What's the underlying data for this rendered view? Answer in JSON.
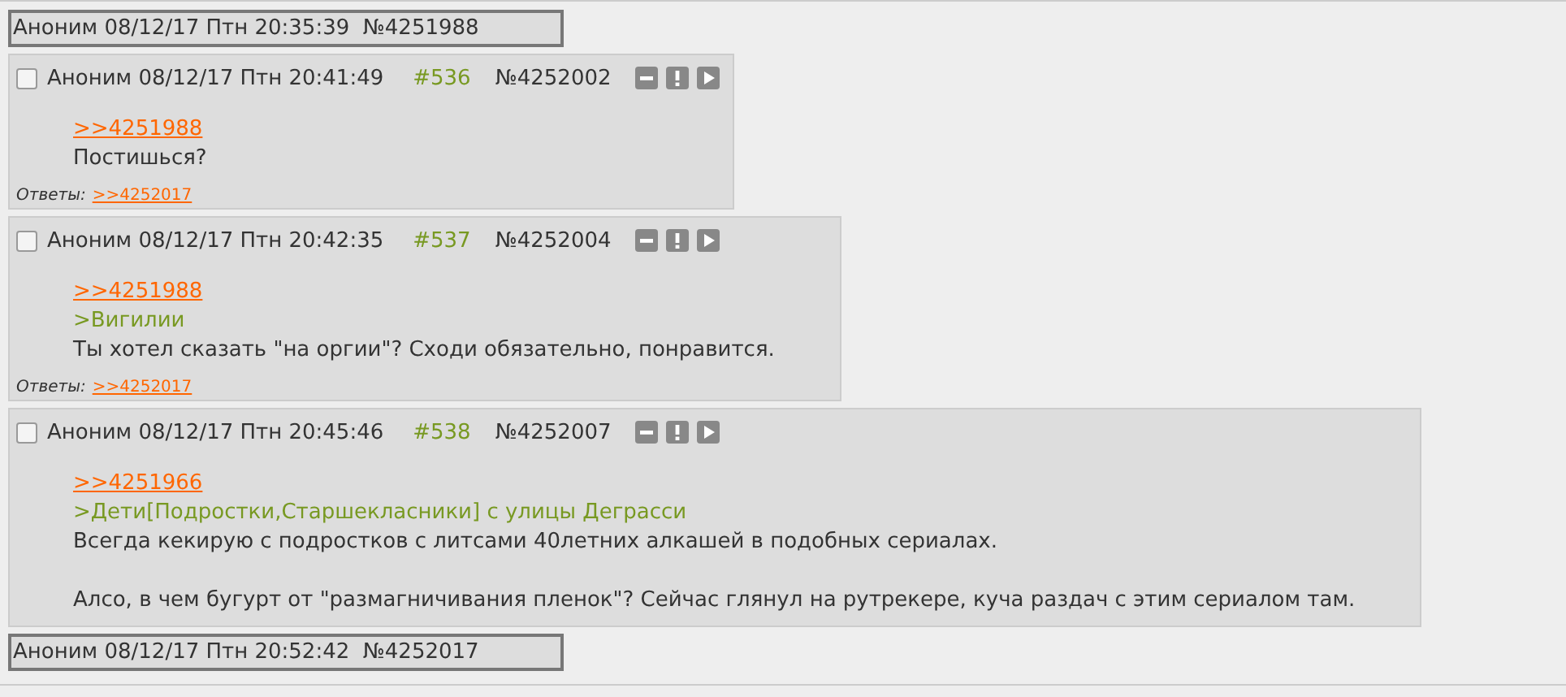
{
  "posts": [
    {
      "kind": "collapsed",
      "author": "Аноним",
      "date": "08/12/17 Птн 20:35:39",
      "number": "№4251988"
    },
    {
      "kind": "full",
      "checked": false,
      "author": "Аноним",
      "date": "08/12/17 Птн 20:41:49",
      "ordinal": "#536",
      "number": "№4252002",
      "paragraphs": [
        [
          {
            "kind": "link",
            "text": ">>4251988"
          },
          {
            "kind": "text",
            "text": "Постишься?"
          }
        ]
      ],
      "replies_label": "Ответы:",
      "replies": [
        ">>4252017"
      ]
    },
    {
      "kind": "full",
      "checked": false,
      "author": "Аноним",
      "date": "08/12/17 Птн 20:42:35",
      "ordinal": "#537",
      "number": "№4252004",
      "paragraphs": [
        [
          {
            "kind": "link",
            "text": ">>4251988"
          },
          {
            "kind": "quote",
            "text": ">Вигилии"
          },
          {
            "kind": "text",
            "text": "Ты хотел сказать \"на оргии\"? Сходи обязательно, понравится."
          }
        ]
      ],
      "replies_label": "Ответы:",
      "replies": [
        ">>4252017"
      ]
    },
    {
      "kind": "full",
      "checked": false,
      "author": "Аноним",
      "date": "08/12/17 Птн 20:45:46",
      "ordinal": "#538",
      "number": "№4252007",
      "paragraphs": [
        [
          {
            "kind": "link",
            "text": ">>4251966"
          },
          {
            "kind": "quote",
            "text": ">Дети[Подростки,Старшекласники] с улицы Деграсси"
          },
          {
            "kind": "text",
            "text": "Всегда кекирую с подростков с литсами 40летних алкашей в подобных сериалах."
          }
        ],
        [
          {
            "kind": "text",
            "text": "Алсо, в чем бугурт от \"размагничивания пленок\"? Сейчас глянул на рутрекере, куча раздач с этим сериалом там."
          }
        ]
      ]
    },
    {
      "kind": "collapsed",
      "author": "Аноним",
      "date": "08/12/17 Птн 20:52:42",
      "number": "№4252017"
    }
  ]
}
